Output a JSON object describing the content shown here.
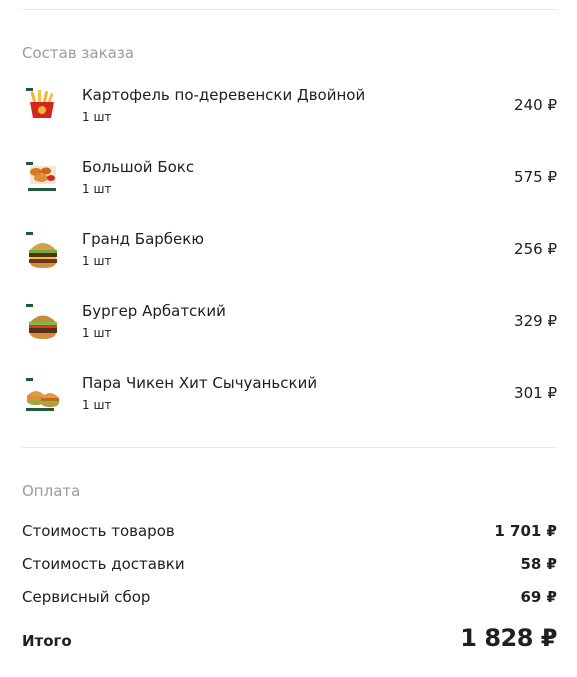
{
  "order": {
    "title": "Состав заказа",
    "items": [
      {
        "name": "Картофель по-деревенски Двойной",
        "qty": "1 шт",
        "price": "240 ₽",
        "icon": "fries-icon"
      },
      {
        "name": "Большой Бокс",
        "qty": "1 шт",
        "price": "575 ₽",
        "icon": "chicken-box-icon"
      },
      {
        "name": "Гранд Барбекю",
        "qty": "1 шт",
        "price": "256 ₽",
        "icon": "burger-icon"
      },
      {
        "name": "Бургер Арбатский",
        "qty": "1 шт",
        "price": "329 ₽",
        "icon": "burger-icon"
      },
      {
        "name": "Пара Чикен Хит Сычуаньский",
        "qty": "1 шт",
        "price": "301 ₽",
        "icon": "double-burger-icon"
      }
    ]
  },
  "payment": {
    "title": "Оплата",
    "rows": [
      {
        "label": "Стоимость товаров",
        "value": "1 701 ₽"
      },
      {
        "label": "Стоимость доставки",
        "value": "58 ₽"
      },
      {
        "label": "Сервисный сбор",
        "value": "69 ₽"
      }
    ],
    "total_label": "Итого",
    "total_value": "1 828 ₽"
  }
}
